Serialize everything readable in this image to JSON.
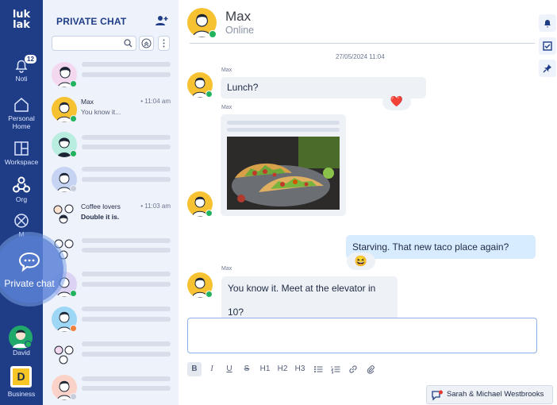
{
  "rail": {
    "logo_line1": "luk",
    "logo_line2": "lak",
    "items": [
      {
        "label": "Noti",
        "badge": "12"
      },
      {
        "label_line1": "Personal",
        "label_line2": "Home"
      },
      {
        "label": "Workspace"
      },
      {
        "label": "Org"
      },
      {
        "label": "M"
      },
      {
        "label": "Private chat"
      },
      {
        "label": "David"
      },
      {
        "label": "Business",
        "logo_letter": "D"
      }
    ]
  },
  "sidebar": {
    "title": "PRIVATE CHAT",
    "conversations": [
      {
        "name": "Max",
        "time": "• 11:04 am",
        "preview": "You know it..."
      },
      {
        "name": "Coffee lovers",
        "time": "• 11:03 am",
        "preview": "Double it is."
      }
    ]
  },
  "chat": {
    "contact_name": "Max",
    "contact_status": "Online",
    "date_stamp": "27/05/2024 11:04",
    "messages": [
      {
        "sender": "Max",
        "text": "Lunch?",
        "reaction": "❤️"
      },
      {
        "sender": "Max",
        "type": "image"
      },
      {
        "sender": "me",
        "text": "Starving. That new taco place again?",
        "reaction": "😆"
      },
      {
        "sender": "Max",
        "text": "You know it. Meet at the elevator in 10?"
      }
    ],
    "toolbar": [
      "B",
      "I",
      "U",
      "S",
      "H1",
      "H2",
      "H3"
    ],
    "footer_chat": "Sarah & Michael Westbrooks"
  },
  "colors": {
    "rail_bg": "#1f3d86",
    "sidebar_bg": "#eef2fb",
    "my_bubble": "#d7ecff",
    "online": "#22b35e",
    "away": "#f0803c"
  }
}
